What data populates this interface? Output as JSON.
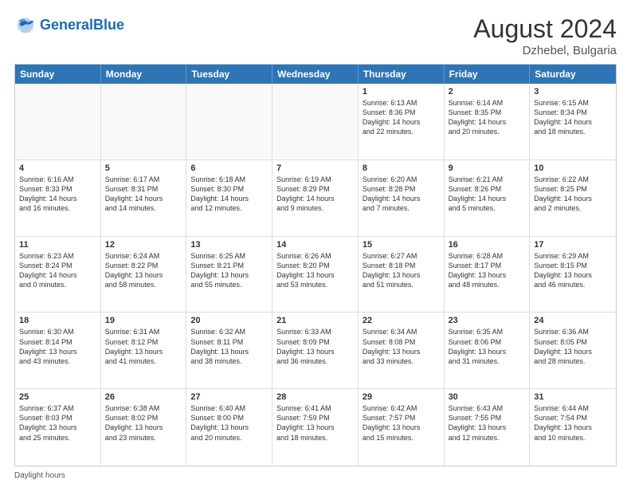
{
  "header": {
    "logo_text_general": "General",
    "logo_text_blue": "Blue",
    "month_year": "August 2024",
    "location": "Dzhebel, Bulgaria"
  },
  "days_of_week": [
    "Sunday",
    "Monday",
    "Tuesday",
    "Wednesday",
    "Thursday",
    "Friday",
    "Saturday"
  ],
  "weeks": [
    [
      {
        "day": "",
        "info": ""
      },
      {
        "day": "",
        "info": ""
      },
      {
        "day": "",
        "info": ""
      },
      {
        "day": "",
        "info": ""
      },
      {
        "day": "1",
        "info": "Sunrise: 6:13 AM\nSunset: 8:36 PM\nDaylight: 14 hours\nand 22 minutes."
      },
      {
        "day": "2",
        "info": "Sunrise: 6:14 AM\nSunset: 8:35 PM\nDaylight: 14 hours\nand 20 minutes."
      },
      {
        "day": "3",
        "info": "Sunrise: 6:15 AM\nSunset: 8:34 PM\nDaylight: 14 hours\nand 18 minutes."
      }
    ],
    [
      {
        "day": "4",
        "info": "Sunrise: 6:16 AM\nSunset: 8:33 PM\nDaylight: 14 hours\nand 16 minutes."
      },
      {
        "day": "5",
        "info": "Sunrise: 6:17 AM\nSunset: 8:31 PM\nDaylight: 14 hours\nand 14 minutes."
      },
      {
        "day": "6",
        "info": "Sunrise: 6:18 AM\nSunset: 8:30 PM\nDaylight: 14 hours\nand 12 minutes."
      },
      {
        "day": "7",
        "info": "Sunrise: 6:19 AM\nSunset: 8:29 PM\nDaylight: 14 hours\nand 9 minutes."
      },
      {
        "day": "8",
        "info": "Sunrise: 6:20 AM\nSunset: 8:28 PM\nDaylight: 14 hours\nand 7 minutes."
      },
      {
        "day": "9",
        "info": "Sunrise: 6:21 AM\nSunset: 8:26 PM\nDaylight: 14 hours\nand 5 minutes."
      },
      {
        "day": "10",
        "info": "Sunrise: 6:22 AM\nSunset: 8:25 PM\nDaylight: 14 hours\nand 2 minutes."
      }
    ],
    [
      {
        "day": "11",
        "info": "Sunrise: 6:23 AM\nSunset: 8:24 PM\nDaylight: 14 hours\nand 0 minutes."
      },
      {
        "day": "12",
        "info": "Sunrise: 6:24 AM\nSunset: 8:22 PM\nDaylight: 13 hours\nand 58 minutes."
      },
      {
        "day": "13",
        "info": "Sunrise: 6:25 AM\nSunset: 8:21 PM\nDaylight: 13 hours\nand 55 minutes."
      },
      {
        "day": "14",
        "info": "Sunrise: 6:26 AM\nSunset: 8:20 PM\nDaylight: 13 hours\nand 53 minutes."
      },
      {
        "day": "15",
        "info": "Sunrise: 6:27 AM\nSunset: 8:18 PM\nDaylight: 13 hours\nand 51 minutes."
      },
      {
        "day": "16",
        "info": "Sunrise: 6:28 AM\nSunset: 8:17 PM\nDaylight: 13 hours\nand 48 minutes."
      },
      {
        "day": "17",
        "info": "Sunrise: 6:29 AM\nSunset: 8:15 PM\nDaylight: 13 hours\nand 46 minutes."
      }
    ],
    [
      {
        "day": "18",
        "info": "Sunrise: 6:30 AM\nSunset: 8:14 PM\nDaylight: 13 hours\nand 43 minutes."
      },
      {
        "day": "19",
        "info": "Sunrise: 6:31 AM\nSunset: 8:12 PM\nDaylight: 13 hours\nand 41 minutes."
      },
      {
        "day": "20",
        "info": "Sunrise: 6:32 AM\nSunset: 8:11 PM\nDaylight: 13 hours\nand 38 minutes."
      },
      {
        "day": "21",
        "info": "Sunrise: 6:33 AM\nSunset: 8:09 PM\nDaylight: 13 hours\nand 36 minutes."
      },
      {
        "day": "22",
        "info": "Sunrise: 6:34 AM\nSunset: 8:08 PM\nDaylight: 13 hours\nand 33 minutes."
      },
      {
        "day": "23",
        "info": "Sunrise: 6:35 AM\nSunset: 8:06 PM\nDaylight: 13 hours\nand 31 minutes."
      },
      {
        "day": "24",
        "info": "Sunrise: 6:36 AM\nSunset: 8:05 PM\nDaylight: 13 hours\nand 28 minutes."
      }
    ],
    [
      {
        "day": "25",
        "info": "Sunrise: 6:37 AM\nSunset: 8:03 PM\nDaylight: 13 hours\nand 25 minutes."
      },
      {
        "day": "26",
        "info": "Sunrise: 6:38 AM\nSunset: 8:02 PM\nDaylight: 13 hours\nand 23 minutes."
      },
      {
        "day": "27",
        "info": "Sunrise: 6:40 AM\nSunset: 8:00 PM\nDaylight: 13 hours\nand 20 minutes."
      },
      {
        "day": "28",
        "info": "Sunrise: 6:41 AM\nSunset: 7:59 PM\nDaylight: 13 hours\nand 18 minutes."
      },
      {
        "day": "29",
        "info": "Sunrise: 6:42 AM\nSunset: 7:57 PM\nDaylight: 13 hours\nand 15 minutes."
      },
      {
        "day": "30",
        "info": "Sunrise: 6:43 AM\nSunset: 7:55 PM\nDaylight: 13 hours\nand 12 minutes."
      },
      {
        "day": "31",
        "info": "Sunrise: 6:44 AM\nSunset: 7:54 PM\nDaylight: 13 hours\nand 10 minutes."
      }
    ]
  ],
  "footer": {
    "daylight_hours_label": "Daylight hours"
  }
}
